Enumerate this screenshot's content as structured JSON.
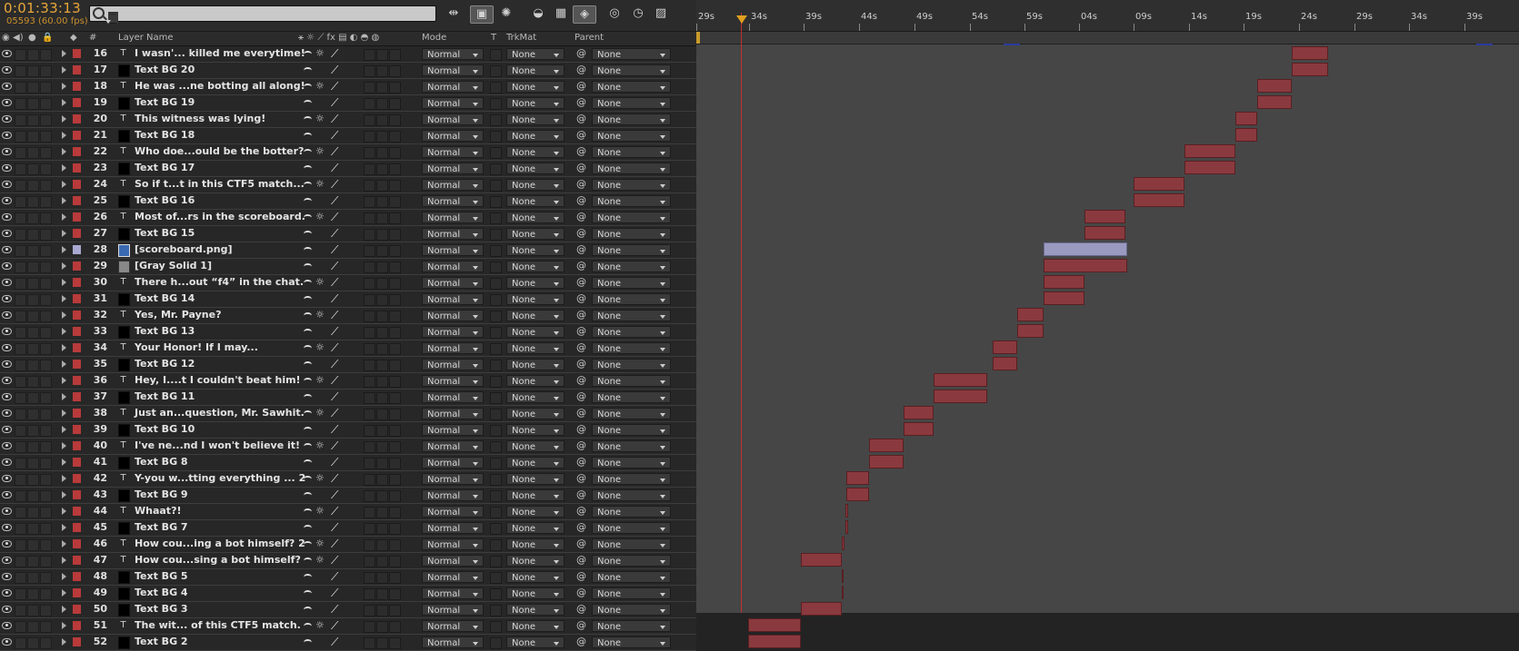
{
  "composition": {
    "timecode": "0:01:33:13",
    "frames": "05593 (60.00 fps)"
  },
  "search": {
    "placeholder": ""
  },
  "toolbar": [
    "comp-mini-flowchart-icon",
    "draft-3d-icon",
    "shy-layers-icon",
    "frame-blending-icon",
    "motion-blur-icon",
    "brainstorm-icon",
    "graph-editor-icon",
    "stopwatch-icon",
    "render-icon"
  ],
  "columns": {
    "layer_name": "Layer Name",
    "num": "#",
    "mode": "Mode",
    "t": "T",
    "trkmat": "TrkMat",
    "parent": "Parent"
  },
  "ruler": [
    "29s",
    "34s",
    "39s",
    "44s",
    "49s",
    "54s",
    "59s",
    "04s",
    "09s",
    "14s",
    "19s",
    "24s",
    "29s",
    "34s",
    "39s"
  ],
  "layers": [
    {
      "num": "16",
      "name": "I wasn'... killed me everytime!",
      "type": "text",
      "color": "#b83a3a",
      "mode": "Normal",
      "trkmat": "None",
      "parent": "None"
    },
    {
      "num": "17",
      "name": "Text BG 20",
      "type": "solid",
      "color": "#b83a3a",
      "mode": "Normal",
      "trkmat": "None",
      "parent": "None"
    },
    {
      "num": "18",
      "name": "He was ...ne botting all along!",
      "type": "text",
      "color": "#b83a3a",
      "mode": "Normal",
      "trkmat": "None",
      "parent": "None"
    },
    {
      "num": "19",
      "name": "Text BG 19",
      "type": "solid",
      "color": "#b83a3a",
      "mode": "Normal",
      "trkmat": "None",
      "parent": "None"
    },
    {
      "num": "20",
      "name": "This witness was lying!",
      "type": "text",
      "color": "#b83a3a",
      "mode": "Normal",
      "trkmat": "None",
      "parent": "None"
    },
    {
      "num": "21",
      "name": "Text BG 18",
      "type": "solid",
      "color": "#b83a3a",
      "mode": "Normal",
      "trkmat": "None",
      "parent": "None"
    },
    {
      "num": "22",
      "name": "Who doe...ould be the botter?",
      "type": "text",
      "color": "#b83a3a",
      "mode": "Normal",
      "trkmat": "None",
      "parent": "None"
    },
    {
      "num": "23",
      "name": "Text BG 17",
      "type": "solid",
      "color": "#b83a3a",
      "mode": "Normal",
      "trkmat": "None",
      "parent": "None"
    },
    {
      "num": "24",
      "name": "So if t...t in this CTF5 match...",
      "type": "text",
      "color": "#b83a3a",
      "mode": "Normal",
      "trkmat": "None",
      "parent": "None"
    },
    {
      "num": "25",
      "name": "Text BG 16",
      "type": "solid",
      "color": "#b83a3a",
      "mode": "Normal",
      "trkmat": "None",
      "parent": "None"
    },
    {
      "num": "26",
      "name": "Most of...rs in the scoreboard.",
      "type": "text",
      "color": "#b83a3a",
      "mode": "Normal",
      "trkmat": "None",
      "parent": "None"
    },
    {
      "num": "27",
      "name": "Text BG 15",
      "type": "solid",
      "color": "#b83a3a",
      "mode": "Normal",
      "trkmat": "None",
      "parent": "None"
    },
    {
      "num": "28",
      "name": "[scoreboard.png]",
      "type": "image",
      "color": "#a8a8d0",
      "mode": "Normal",
      "trkmat": "None",
      "parent": "None"
    },
    {
      "num": "29",
      "name": "[Gray Solid 1]",
      "type": "gray",
      "color": "#b83a3a",
      "mode": "Normal",
      "trkmat": "None",
      "parent": "None"
    },
    {
      "num": "30",
      "name": "There h...out “f4” in the chat.",
      "type": "text",
      "color": "#b83a3a",
      "mode": "Normal",
      "trkmat": "None",
      "parent": "None"
    },
    {
      "num": "31",
      "name": "Text BG 14",
      "type": "solid",
      "color": "#b83a3a",
      "mode": "Normal",
      "trkmat": "None",
      "parent": "None"
    },
    {
      "num": "32",
      "name": "Yes, Mr. Payne?",
      "type": "text",
      "color": "#b83a3a",
      "mode": "Normal",
      "trkmat": "None",
      "parent": "None"
    },
    {
      "num": "33",
      "name": "Text BG 13",
      "type": "solid",
      "color": "#b83a3a",
      "mode": "Normal",
      "trkmat": "None",
      "parent": "None"
    },
    {
      "num": "34",
      "name": "Your Honor! If I may...",
      "type": "text",
      "color": "#b83a3a",
      "mode": "Normal",
      "trkmat": "None",
      "parent": "None"
    },
    {
      "num": "35",
      "name": "Text BG 12",
      "type": "solid",
      "color": "#b83a3a",
      "mode": "Normal",
      "trkmat": "None",
      "parent": "None"
    },
    {
      "num": "36",
      "name": "Hey, I....t I couldn't beat him!",
      "type": "text",
      "color": "#b83a3a",
      "mode": "Normal",
      "trkmat": "None",
      "parent": "None"
    },
    {
      "num": "37",
      "name": "Text BG 11",
      "type": "solid",
      "color": "#b83a3a",
      "mode": "Normal",
      "trkmat": "None",
      "parent": "None"
    },
    {
      "num": "38",
      "name": "Just an...question, Mr. Sawhit.",
      "type": "text",
      "color": "#b83a3a",
      "mode": "Normal",
      "trkmat": "None",
      "parent": "None"
    },
    {
      "num": "39",
      "name": "Text BG 10",
      "type": "solid",
      "color": "#b83a3a",
      "mode": "Normal",
      "trkmat": "None",
      "parent": "None"
    },
    {
      "num": "40",
      "name": "I've ne...nd I won't believe it!",
      "type": "text",
      "color": "#b83a3a",
      "mode": "Normal",
      "trkmat": "None",
      "parent": "None"
    },
    {
      "num": "41",
      "name": "Text BG 8",
      "type": "solid",
      "color": "#b83a3a",
      "mode": "Normal",
      "trkmat": "None",
      "parent": "None"
    },
    {
      "num": "42",
      "name": "Y-you w...tting everything ... 2",
      "type": "text",
      "color": "#b83a3a",
      "mode": "Normal",
      "trkmat": "None",
      "parent": "None"
    },
    {
      "num": "43",
      "name": "Text BG 9",
      "type": "solid",
      "color": "#b83a3a",
      "mode": "Normal",
      "trkmat": "None",
      "parent": "None"
    },
    {
      "num": "44",
      "name": "Whaat?!",
      "type": "text",
      "color": "#b83a3a",
      "mode": "Normal",
      "trkmat": "None",
      "parent": "None"
    },
    {
      "num": "45",
      "name": "Text BG 7",
      "type": "solid",
      "color": "#b83a3a",
      "mode": "Normal",
      "trkmat": "None",
      "parent": "None"
    },
    {
      "num": "46",
      "name": "How cou...ing a bot himself? 2",
      "type": "text",
      "color": "#b83a3a",
      "mode": "Normal",
      "trkmat": "None",
      "parent": "None"
    },
    {
      "num": "47",
      "name": "How cou...sing a bot himself?",
      "type": "text",
      "color": "#b83a3a",
      "mode": "Normal",
      "trkmat": "None",
      "parent": "None"
    },
    {
      "num": "48",
      "name": "Text BG 5",
      "type": "solid",
      "color": "#b83a3a",
      "mode": "Normal",
      "trkmat": "None",
      "parent": "None"
    },
    {
      "num": "49",
      "name": "Text BG 4",
      "type": "solid",
      "color": "#b83a3a",
      "mode": "Normal",
      "trkmat": "None",
      "parent": "None"
    },
    {
      "num": "50",
      "name": "Text BG 3",
      "type": "solid",
      "color": "#b83a3a",
      "mode": "Normal",
      "trkmat": "None",
      "parent": "None"
    },
    {
      "num": "51",
      "name": "The wit... of this  CTF5  match.",
      "type": "text",
      "color": "#b83a3a",
      "mode": "Normal",
      "trkmat": "None",
      "parent": "None"
    },
    {
      "num": "52",
      "name": "Text BG 2",
      "type": "solid",
      "color": "#b83a3a",
      "mode": "Normal",
      "trkmat": "None",
      "parent": "None"
    }
  ]
}
